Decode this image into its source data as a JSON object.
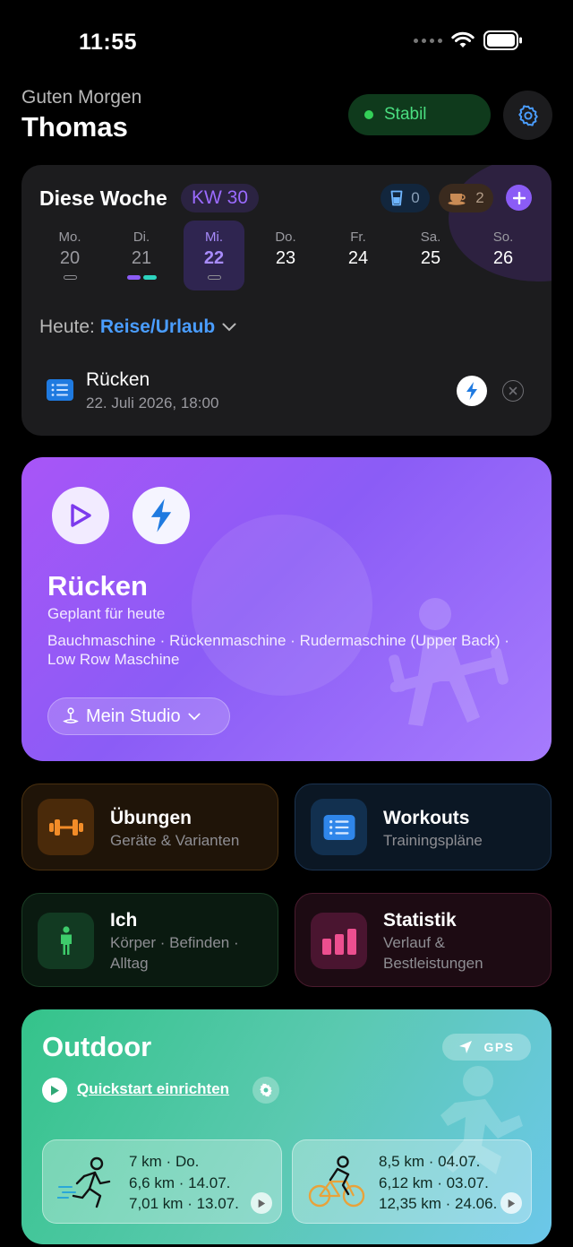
{
  "status_bar": {
    "time": "11:55"
  },
  "header": {
    "greeting": "Guten Morgen",
    "name": "Thomas",
    "status_label": "Stabil",
    "status_color": "#34d058"
  },
  "week": {
    "title": "Diese Woche",
    "kw": "KW 30",
    "water_count": "0",
    "coffee_count": "2",
    "days": [
      {
        "name": "Mo.",
        "num": "20"
      },
      {
        "name": "Di.",
        "num": "21"
      },
      {
        "name": "Mi.",
        "num": "22"
      },
      {
        "name": "Do.",
        "num": "23"
      },
      {
        "name": "Fr.",
        "num": "24"
      },
      {
        "name": "Sa.",
        "num": "25"
      },
      {
        "name": "So.",
        "num": "26"
      }
    ],
    "today_label": "Heute:",
    "today_value": "Reise/Urlaub",
    "session": {
      "title": "Rücken",
      "date": "22. Juli 2026, 18:00"
    }
  },
  "hero": {
    "title": "Rücken",
    "subtitle": "Geplant für heute",
    "exercises": "Bauchmaschine · Rückenmaschine · Rudermaschine (Upper Back) · Low Row Maschine",
    "studio": "Mein Studio"
  },
  "tiles": {
    "uebungen": {
      "title": "Übungen",
      "sub": "Geräte & Varianten"
    },
    "workouts": {
      "title": "Workouts",
      "sub": "Trainingspläne"
    },
    "ich": {
      "title": "Ich",
      "sub": "Körper · Befinden · Alltag"
    },
    "statistik": {
      "title": "Statistik",
      "sub": "Verlauf & Bestleistungen"
    }
  },
  "outdoor": {
    "title": "Outdoor",
    "gps": "GPS",
    "quickstart": "Quickstart einrichten",
    "run": [
      "7 km · Do.",
      "6,6 km · 14.07.",
      "7,01 km · 13.07."
    ],
    "bike": [
      "8,5 km · 04.07.",
      "6,12 km · 03.07.",
      "12,35 km · 24.06."
    ]
  },
  "colors": {
    "accent_purple": "#8b5cf6",
    "accent_blue": "#4a9dff",
    "stable_green": "#4ade80"
  }
}
